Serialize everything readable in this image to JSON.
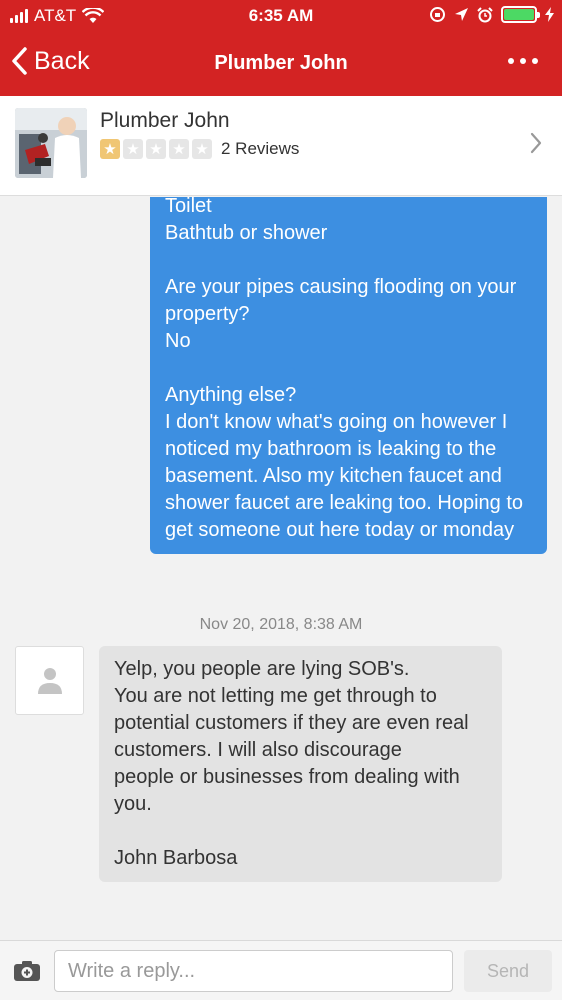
{
  "status_bar": {
    "carrier": "AT&T",
    "time": "6:35 AM",
    "battery_color": "#4cd964"
  },
  "nav": {
    "back_label": "Back",
    "title": "Plumber John",
    "more_icon": "ellipsis-icon"
  },
  "business": {
    "name": "Plumber John",
    "rating": 1,
    "max_rating": 5,
    "reviews": "2 Reviews"
  },
  "messages": {
    "outgoing": {
      "text": "Toilet\nBathtub or shower\n\nAre your pipes causing flooding on your property?\nNo\n\nAnything else?\nI don't know what's going on however I noticed my bathroom is leaking to the basement. Also my kitchen faucet and shower faucet are leaking too. Hoping to get someone out here today or monday"
    },
    "timestamp": "Nov 20, 2018, 8:38 AM",
    "incoming": {
      "text": "Yelp, you people are lying SOB's.\nYou are not letting me get through to\npotential customers if they are even real customers. I will also discourage\npeople or businesses from dealing with you.\n\nJohn Barbosa"
    }
  },
  "reply": {
    "placeholder": "Write a reply...",
    "send_label": "Send"
  },
  "colors": {
    "brand_red": "#d32323",
    "outgoing_bubble": "#3d8fe1",
    "incoming_bubble": "#e3e3e3",
    "star_on": "#f0c674"
  }
}
